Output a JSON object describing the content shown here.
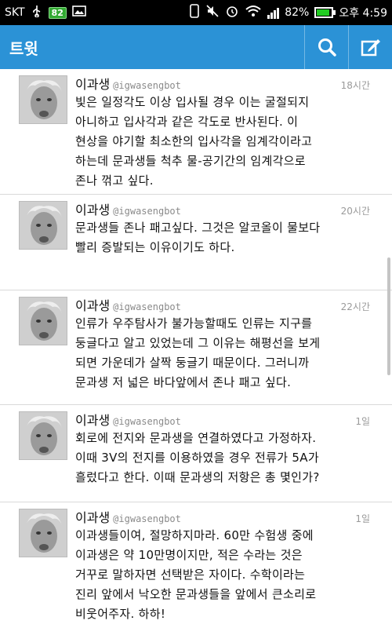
{
  "status_bar": {
    "carrier": "SKT",
    "notification_count": "82",
    "battery_percent": "82%",
    "time": "오후 4:59"
  },
  "app_bar": {
    "title": "트윗",
    "search_icon": "search-icon",
    "compose_icon": "compose-icon"
  },
  "tweets": [
    {
      "name": "이과생",
      "handle": "@igwasengbot",
      "time": "18시간",
      "text": "빛은 일정각도 이상 입사될 경우 이는 굴절되지\n아니하고 입사각과 같은 각도로 반사된다. 이\n현상을 야기할 최소한의 입사각을 임계각이라고\n하는데 문과생들 척추 물-공기간의 임계각으로\n존나 꺾고 싶다."
    },
    {
      "name": "이과생",
      "handle": "@igwasengbot",
      "time": "20시간",
      "text": "문과생들 존나 패고싶다. 그것은 알코올이 물보다\n빨리 증발되는 이유이기도 하다."
    },
    {
      "name": "이과생",
      "handle": "@igwasengbot",
      "time": "22시간",
      "text": "인류가 우주탐사가 불가능할때도 인류는 지구를\n둥글다고 알고 있었는데 그 이유는 해평선을 보게\n되면 가운데가 살짝 둥글기 때문이다. 그러니까\n문과생 저 넓은 바다앞에서 존나 패고 싶다."
    },
    {
      "name": "이과생",
      "handle": "@igwasengbot",
      "time": "1일",
      "text": "회로에 전지와 문과생을 연결하였다고 가정하자.\n이때 3V의 전지를 이용하였을 경우 전류가 5A가\n흘렀다고 한다. 이때 문과생의 저항은 총 몇인가?"
    },
    {
      "name": "이과생",
      "handle": "@igwasengbot",
      "time": "1일",
      "text": "이과생들이여, 절망하지마라. 60만 수험생 중에\n이과생은 약 10만명이지만, 적은 수라는 것은\n거꾸로 말하자면 선택받은 자이다. 수학이라는\n진리 앞에서 낙오한 문과생들을 앞에서 큰소리로\n비웃어주자. 하하!"
    }
  ]
}
